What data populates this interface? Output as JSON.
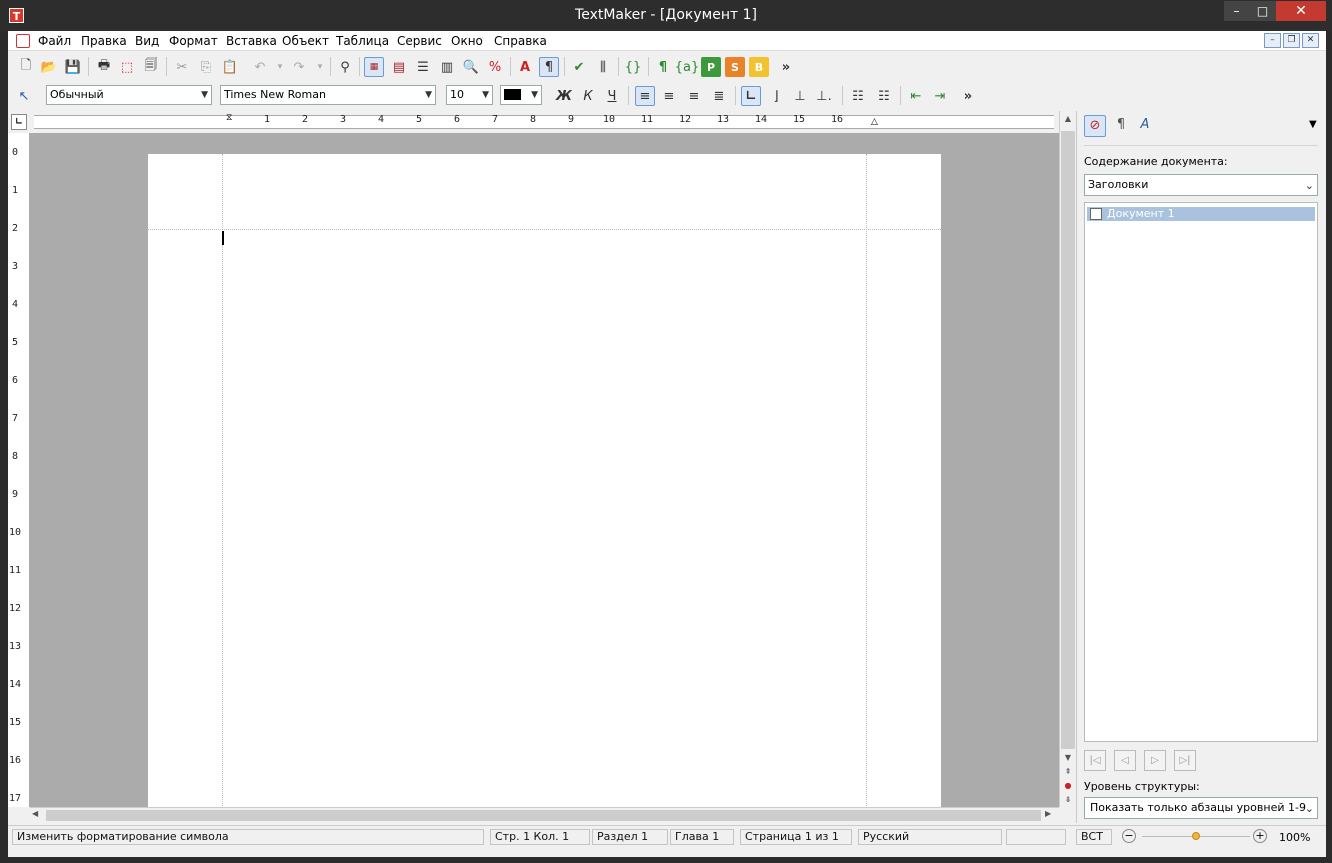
{
  "window": {
    "title": "TextMaker - [Документ 1]",
    "minimize": "–",
    "maximize": "□",
    "close": "✕"
  },
  "menu": [
    "Файл",
    "Правка",
    "Вид",
    "Формат",
    "Вставка",
    "Объект",
    "Таблица",
    "Сервис",
    "Окно",
    "Справка"
  ],
  "format_toolbar": {
    "style": "Обычный",
    "font": "Times New Roman",
    "size": "10"
  },
  "ruler": {
    "numbers": [
      "1",
      "2",
      "3",
      "4",
      "5",
      "6",
      "7",
      "8",
      "9",
      "10",
      "11",
      "12",
      "13",
      "14",
      "15",
      "16"
    ],
    "vnumbers": [
      "0",
      "1",
      "2",
      "3",
      "4",
      "5",
      "6",
      "7",
      "8",
      "9",
      "10",
      "11",
      "12",
      "13",
      "14",
      "15",
      "16",
      "17"
    ]
  },
  "sidebar": {
    "toc_label": "Содержание документа:",
    "toc_mode": "Заголовки",
    "outline_items": [
      "Документ 1"
    ],
    "level_label": "Уровень структуры:",
    "level_value": "Показать только абзацы уровней 1-9"
  },
  "status": {
    "hint": "Изменить форматирование символа",
    "position": "Стр. 1 Кол. 1",
    "section": "Раздел 1",
    "chapter": "Глава 1",
    "page": "Страница 1 из 1",
    "language": "Русский",
    "mode": "ВСТ",
    "zoom": "100%",
    "zoom_level": 0.5
  }
}
